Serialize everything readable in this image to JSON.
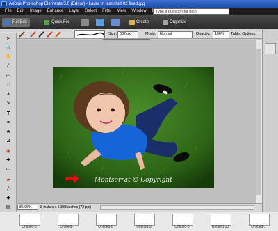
{
  "window": {
    "title": "Adobe Photoshop Elements 5.0 (Editor) - Laura in teal shirt 02 fixed.jpg"
  },
  "menu": [
    "File",
    "Edit",
    "Image",
    "Enhance",
    "Layer",
    "Select",
    "Filter",
    "View",
    "Window",
    "Help"
  ],
  "help": {
    "placeholder": "Type a question for help"
  },
  "modes": {
    "full_edit": "Full Edit",
    "quick_fix": "Quick Fix",
    "create": "Create",
    "organize": "Organize"
  },
  "options": {
    "size_label": "Size:",
    "size_value": "332 px",
    "mode_label": "Mode:",
    "mode_value": "Normal",
    "opacity_label": "Opacity:",
    "opacity_value": "100%",
    "tablet_label": "Tablet Options:"
  },
  "photo": {
    "watermark": "Montserrat © Copyright"
  },
  "status": {
    "zoom": "85.05%",
    "doc_info": "8 inches x 5.333 inches (72 ppi)"
  },
  "photo_bin": [
    "Untitled-5",
    "Untitled-7",
    "Untitled-6",
    "Untitled-9",
    "Untitled-8",
    "Untitled-10",
    "Untitled-1"
  ],
  "colors": {
    "title_bar": "#2a5bbd",
    "menu_bar": "#1d1d1d",
    "grass": "#2f6b16",
    "shirt": "#1565d8",
    "jeans": "#1a2f6a"
  }
}
